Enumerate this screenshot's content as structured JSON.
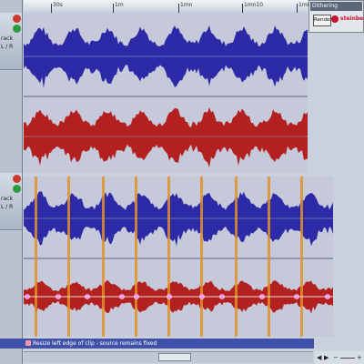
{
  "ruler": {
    "labels": [
      "30s",
      "1m",
      "1mn",
      "1mn10",
      "1mn20"
    ]
  },
  "tracks": [
    {
      "name_label": "rack",
      "channel_label": "L / R"
    },
    {
      "name_label": "rack",
      "channel_label": "L / R"
    }
  ],
  "dithering_panel": {
    "title": "Dithering",
    "render_label": "Render",
    "brand": "steinberg"
  },
  "upper_editor": {
    "caption": ""
  },
  "lower_editor": {
    "caption": ""
  },
  "status_bar": {
    "text": "Resize left edge of clip - source remains fixed"
  },
  "colors": {
    "left_channel": "#2d2aa8",
    "right_channel": "#b32020",
    "editor_bg": "#c5c9da",
    "region_marker": "#e0902a",
    "envelope_point": "#ff66ff"
  },
  "icons": {
    "record": "record-icon",
    "mute": "mute-icon",
    "solo": "solo-icon",
    "scroll_left": "arrow-left-icon",
    "scroll_right": "arrow-right-icon",
    "zoom_minus": "zoom-out-icon",
    "zoom_plus": "zoom-in-icon"
  }
}
